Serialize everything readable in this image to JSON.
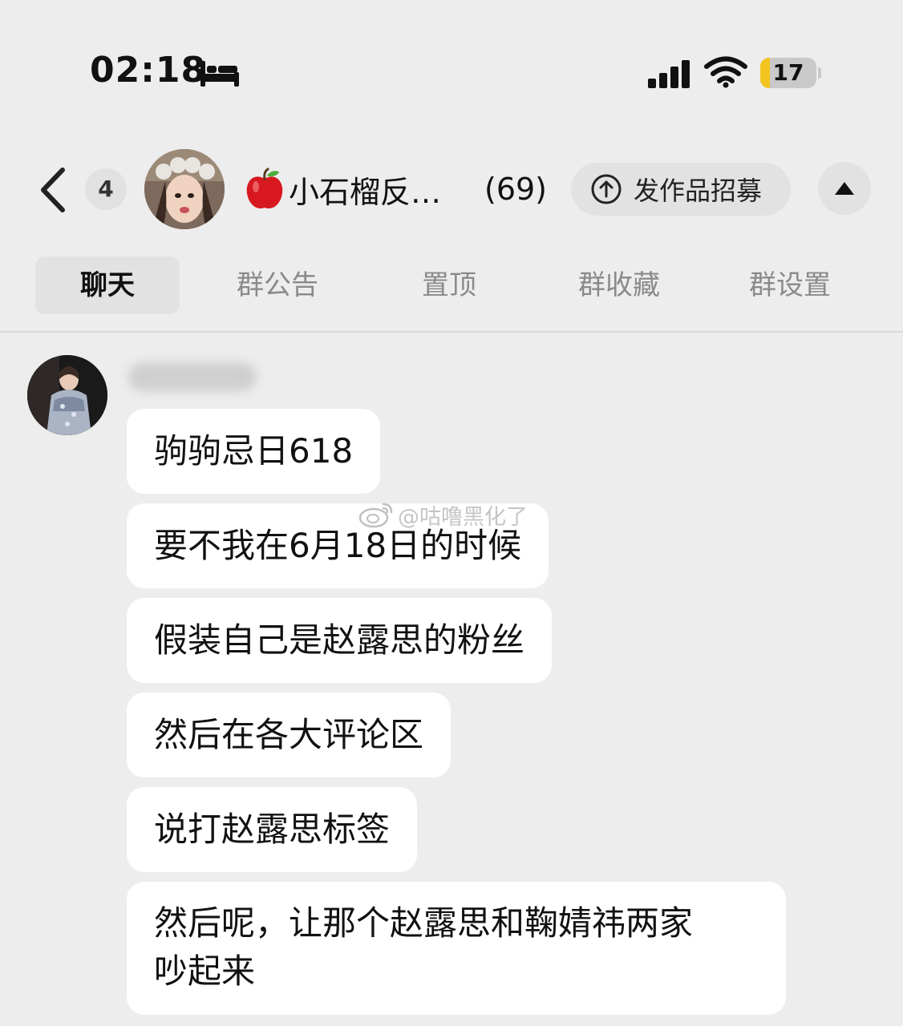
{
  "status_bar": {
    "time": "02:18",
    "icons": [
      "bed-icon",
      "signal-icon",
      "wifi-icon"
    ],
    "battery": {
      "text": "17",
      "level_percent": 17,
      "fill_color": "#f2c41f"
    }
  },
  "header": {
    "unread_count": "4",
    "group_emoji": "apple-icon",
    "group_name": "小石榴反…",
    "member_count": "(69)",
    "recruit_button_label": "发作品招募",
    "icons": [
      "back-chevron-icon",
      "upload-circle-icon",
      "collapse-triangle-icon"
    ]
  },
  "tabs": [
    {
      "label": "聊天",
      "active": true
    },
    {
      "label": "群公告",
      "active": false
    },
    {
      "label": "置顶",
      "active": false
    },
    {
      "label": "群收藏",
      "active": false
    },
    {
      "label": "群设置",
      "active": false
    }
  ],
  "chat": {
    "messages": [
      {
        "text": "驹驹忌日618"
      },
      {
        "text": "要不我在6月18日的时候"
      },
      {
        "text": "假装自己是赵露思的粉丝"
      },
      {
        "text": "然后在各大评论区"
      },
      {
        "text": "说打赵露思标签"
      },
      {
        "text_line1": "然后呢，让那个赵露思和鞠婧祎两家",
        "text_line2": "吵起来"
      }
    ]
  },
  "watermark": {
    "text": "@咕噜黑化了",
    "icon": "weibo-icon"
  },
  "colors": {
    "background": "#ededed",
    "bubble": "#ffffff",
    "tab_active_bg": "#e2e2e2"
  }
}
